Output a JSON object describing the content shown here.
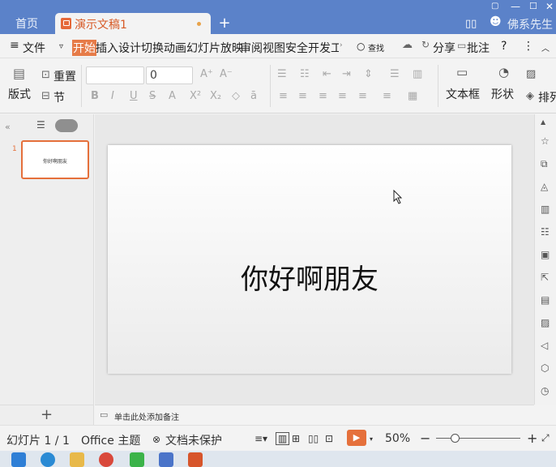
{
  "tabs": {
    "home": "首页",
    "document": "演示文稿1",
    "new_tab": "+"
  },
  "user": {
    "name": "佛系先生"
  },
  "menu": {
    "file": "文件",
    "items": [
      "开始",
      "插入",
      "设计",
      "切换",
      "动画",
      "幻灯片放映",
      "审阅",
      "视图",
      "安全",
      "开发工"
    ],
    "search": "查找",
    "share": "分享",
    "comment": "批注",
    "help": "?"
  },
  "ribbon": {
    "reset": "重置",
    "layout": "版式",
    "section": "节",
    "font_size": "0",
    "textbox": "文本框",
    "shape": "形状",
    "arrange": "排列"
  },
  "slides": [
    {
      "number": "1",
      "text": "你好啊朋友"
    }
  ],
  "notes": {
    "placeholder": "单击此处添加备注"
  },
  "status": {
    "slide_info": "幻灯片 1 / 1",
    "theme": "Office 主题",
    "protection": "文档未保护",
    "zoom": "50%"
  },
  "colors": {
    "title_bar": "#5b82c9",
    "accent": "#e5703b"
  }
}
